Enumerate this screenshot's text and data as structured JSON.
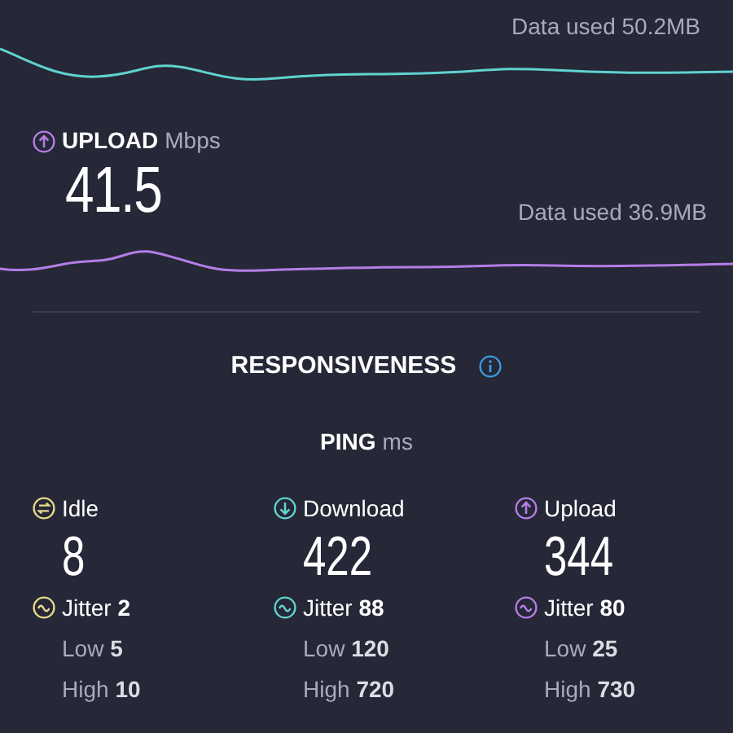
{
  "download": {
    "data_used": "Data used 50.2MB"
  },
  "upload": {
    "label": "UPLOAD",
    "unit": "Mbps",
    "value": "41.5",
    "data_used": "Data used 36.9MB"
  },
  "responsiveness": {
    "title": "RESPONSIVENESS"
  },
  "ping": {
    "label": "PING",
    "unit": "ms",
    "columns": [
      {
        "kind": "idle",
        "label": "Idle",
        "value": "8",
        "jitter": "Jitter **2**",
        "low": "Low **5**",
        "high": "High **10**"
      },
      {
        "kind": "download",
        "label": "Download",
        "value": "422",
        "jitter": "Jitter **88**",
        "low": "Low **120**",
        "high": "High **720**"
      },
      {
        "kind": "upload",
        "label": "Upload",
        "value": "344",
        "jitter": "Jitter **80**",
        "low": "Low **25**",
        "high": "High **730**"
      }
    ]
  }
}
